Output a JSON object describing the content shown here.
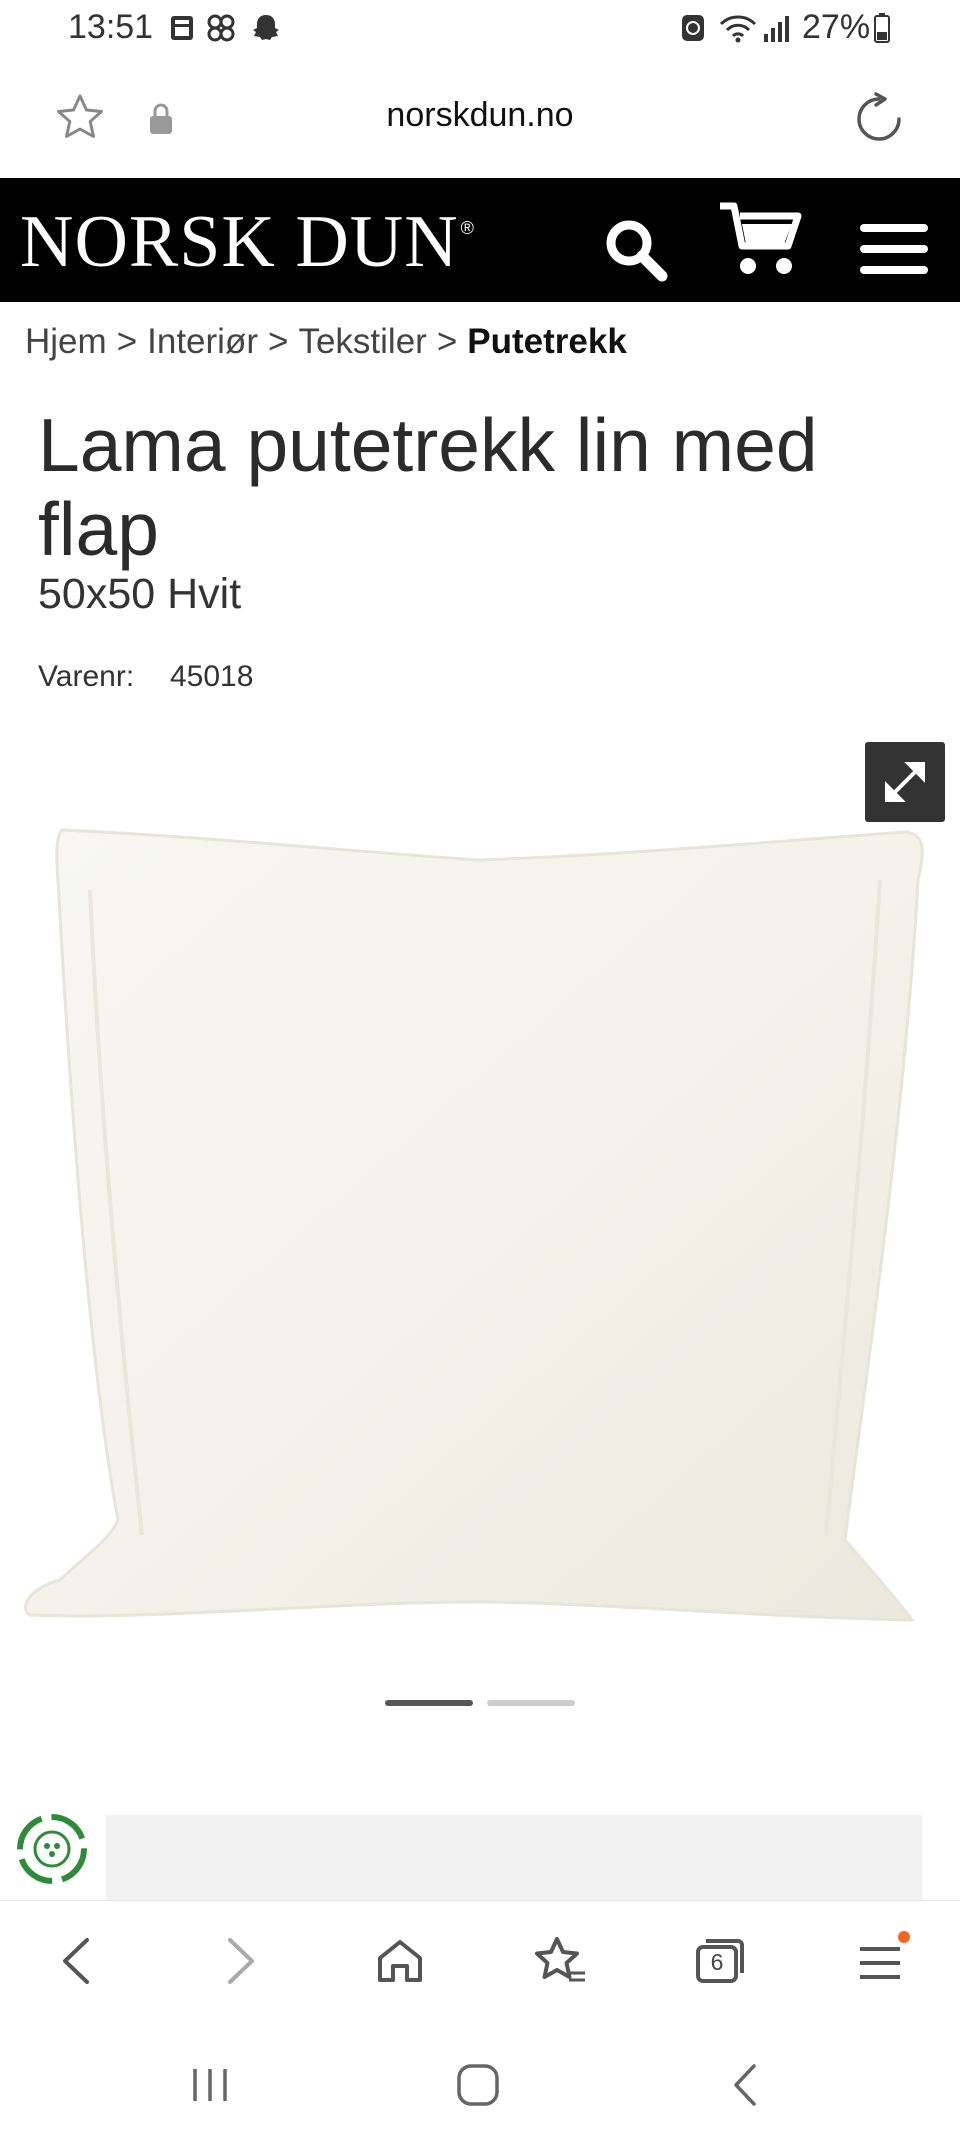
{
  "status_bar": {
    "time": "13:51",
    "battery": "27%"
  },
  "url_bar": {
    "domain": "norskdun.no"
  },
  "site_header": {
    "logo_text": "NORSK DUN",
    "logo_mark": "®"
  },
  "breadcrumb": {
    "items": [
      "Hjem",
      "Interiør",
      "Tekstiler"
    ],
    "current": "Putetrekk",
    "separator": ">"
  },
  "product": {
    "title": "Lama putetrekk lin med flap",
    "variant": "50x50 Hvit",
    "sku_label": "Varenr:",
    "sku": "45018"
  },
  "carousel": {
    "slide_count": 2,
    "active_index": 0
  },
  "browser_toolbar": {
    "tab_count": "6"
  },
  "colors": {
    "header_bg": "#000000",
    "accent_notification": "#f26522",
    "recycle_green": "#2e8b3a"
  }
}
